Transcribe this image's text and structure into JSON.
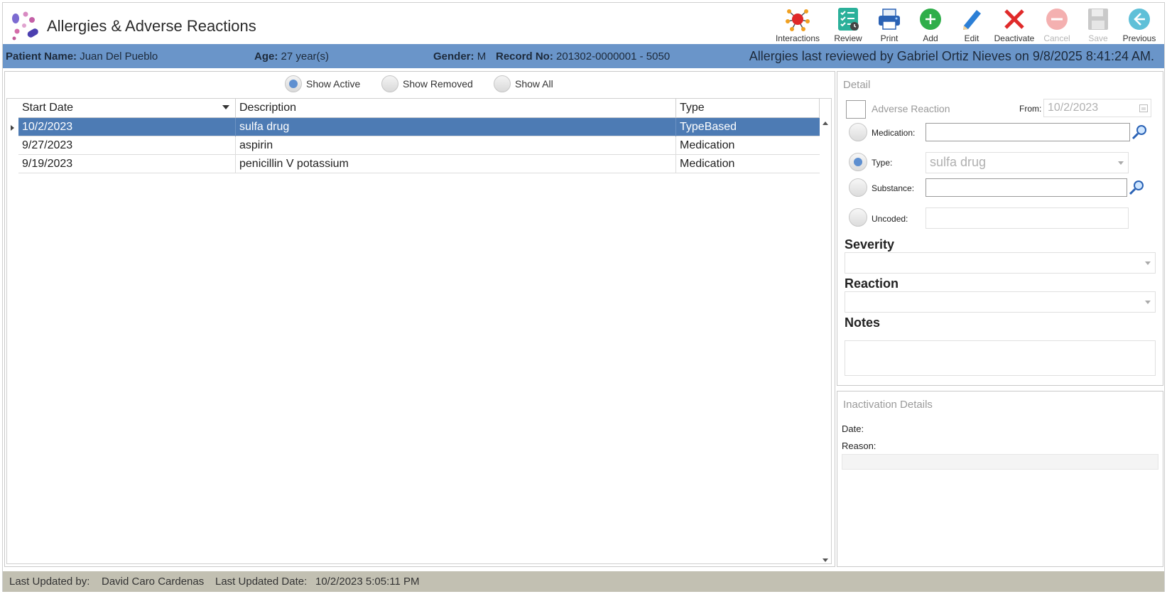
{
  "app": {
    "title": "Allergies & Adverse Reactions"
  },
  "toolbar": [
    {
      "name": "interactions",
      "label": "Interactions",
      "enabled": true
    },
    {
      "name": "review",
      "label": "Review",
      "enabled": true
    },
    {
      "name": "print",
      "label": "Print",
      "enabled": true
    },
    {
      "name": "add",
      "label": "Add",
      "enabled": true
    },
    {
      "name": "edit",
      "label": "Edit",
      "enabled": true
    },
    {
      "name": "deactivate",
      "label": "Deactivate",
      "enabled": true
    },
    {
      "name": "cancel",
      "label": "Cancel",
      "enabled": false
    },
    {
      "name": "save",
      "label": "Save",
      "enabled": false
    },
    {
      "name": "previous",
      "label": "Previous",
      "enabled": true
    }
  ],
  "patient": {
    "name_label": "Patient Name:",
    "name": "Juan Del Pueblo",
    "age_label": "Age:",
    "age": "27 year(s)",
    "gender_label": "Gender:",
    "gender": "M",
    "record_label": "Record No:",
    "record": "201302-0000001 - 5050",
    "review_text": "Allergies last reviewed by Gabriel Ortiz Nieves on 9/8/2025 8:41:24 AM."
  },
  "filters": {
    "show_active": "Show Active",
    "show_removed": "Show Removed",
    "show_all": "Show All",
    "selected": "show_active"
  },
  "grid": {
    "headers": {
      "start_date": "Start Date",
      "description": "Description",
      "type": "Type"
    },
    "rows": [
      {
        "start_date": "10/2/2023",
        "description": "sulfa drug",
        "type": "TypeBased",
        "selected": true
      },
      {
        "start_date": "9/27/2023",
        "description": "aspirin",
        "type": "Medication",
        "selected": false
      },
      {
        "start_date": "9/19/2023",
        "description": "penicillin V potassium",
        "type": "Medication",
        "selected": false
      }
    ]
  },
  "detail": {
    "title": "Detail",
    "adverse_reaction_label": "Adverse Reaction",
    "from_label": "From:",
    "from_value": "10/2/2023",
    "medication_label": "Medication:",
    "medication_value": "",
    "type_label": "Type:",
    "type_value": "sulfa drug",
    "substance_label": "Substance:",
    "substance_value": "",
    "uncoded_label": "Uncoded:",
    "uncoded_value": "",
    "severity_label": "Severity",
    "severity_value": "",
    "reaction_label": "Reaction",
    "reaction_value": "",
    "notes_label": "Notes",
    "notes_value": "",
    "selected_source": "type"
  },
  "inactivation": {
    "title": "Inactivation Details",
    "date_label": "Date:",
    "date_value": "",
    "reason_label": "Reason:",
    "reason_value": ""
  },
  "status": {
    "updated_by_label": "Last Updated by:",
    "updated_by": "David Caro Cardenas",
    "updated_date_label": "Last Updated Date:",
    "updated_date": "10/2/2023 5:05:11 PM"
  },
  "colors": {
    "patient_bar": "#6a95c9",
    "selected_row": "#4d7bb4",
    "status_bar": "#c2c0b2"
  }
}
